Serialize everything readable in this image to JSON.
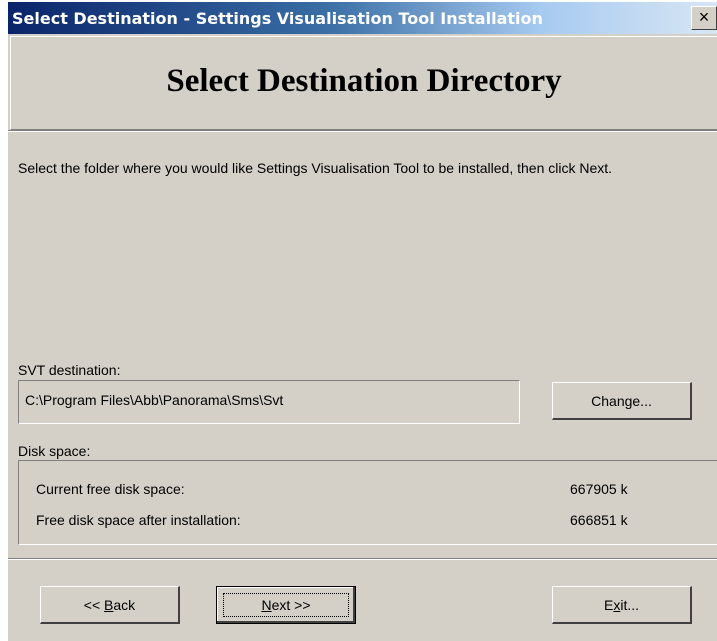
{
  "window": {
    "title": "Select Destination - Settings Visualisation Tool Installation",
    "close_glyph": "×"
  },
  "header": {
    "title": "Select Destination Directory"
  },
  "instruction": "Select the folder where you would like Settings Visualisation Tool to be installed, then click Next.",
  "destination": {
    "label": "SVT destination:",
    "path": "C:\\Program Files\\Abb\\Panorama\\Sms\\Svt",
    "change_button": "Change..."
  },
  "disk": {
    "label": "Disk space:",
    "rows": [
      {
        "label": "Current free disk space:",
        "value": "667905 k"
      },
      {
        "label": "Free disk space after installation:",
        "value": "666851 k"
      }
    ]
  },
  "buttons": {
    "back_prefix": "<< ",
    "back_mnemonic": "B",
    "back_rest": "ack",
    "next_mnemonic": "N",
    "next_rest": "ext >>",
    "exit_prefix": "E",
    "exit_mnemonic": "x",
    "exit_rest": "it..."
  }
}
